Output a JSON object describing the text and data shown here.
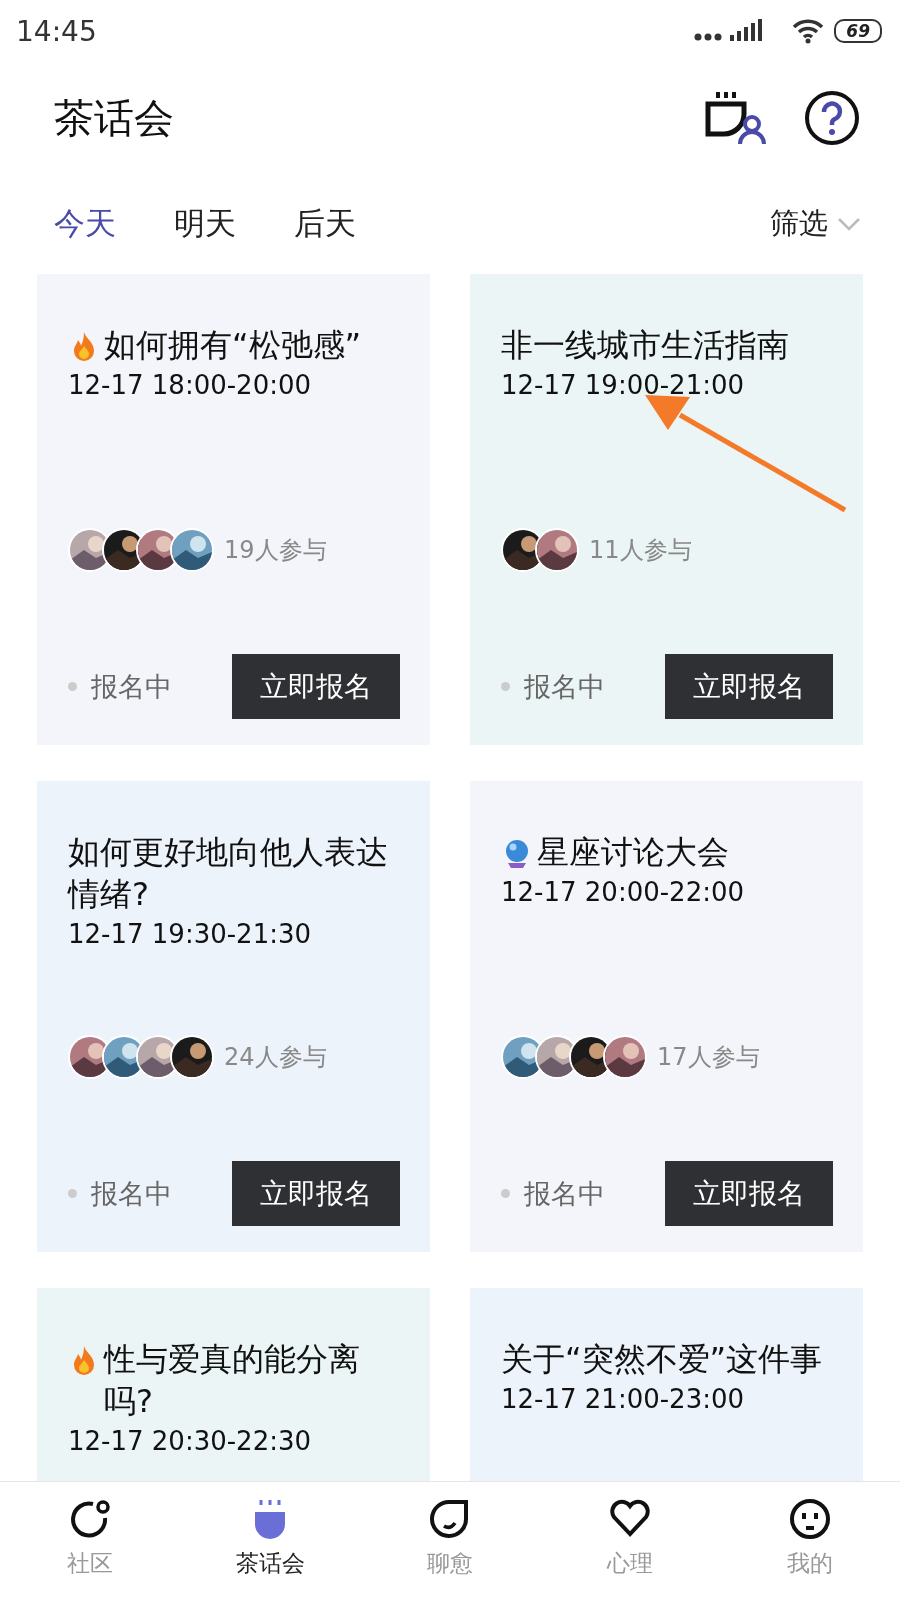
{
  "status_bar": {
    "time": "14:45",
    "battery": "69"
  },
  "header": {
    "title": "茶话会"
  },
  "tabs": [
    {
      "label": "今天",
      "selected": true
    },
    {
      "label": "明天",
      "selected": false
    },
    {
      "label": "后天",
      "selected": false
    }
  ],
  "filter": {
    "label": "筛选"
  },
  "cards": [
    {
      "kind": "fire",
      "title": "如何拥有“松弛感”",
      "time": "12-17 18:00-20:00",
      "participants": "19人参与",
      "status": "报名中",
      "button": "立即报名"
    },
    {
      "title": "非一线城市生活指南",
      "time": "12-17 19:00-21:00",
      "participants": "11人参与",
      "status": "报名中",
      "button": "立即报名"
    },
    {
      "title": "如何更好地向他人表达情绪?",
      "time": "12-17 19:30-21:30",
      "participants": "24人参与",
      "status": "报名中",
      "button": "立即报名"
    },
    {
      "kind": "crystal-ball",
      "title": "星座讨论大会",
      "time": "12-17 20:00-22:00",
      "participants": "17人参与",
      "status": "报名中",
      "button": "立即报名"
    },
    {
      "kind": "fire",
      "title": "性与爱真的能分离吗?",
      "time": "12-17 20:30-22:30"
    },
    {
      "title": "关于“突然不爱”这件事",
      "time": "12-17 21:00-23:00"
    }
  ],
  "bottom_nav": [
    {
      "label": "社区",
      "selected": false
    },
    {
      "label": "茶话会",
      "selected": true
    },
    {
      "label": "聊愈",
      "selected": false
    },
    {
      "label": "心理",
      "selected": false
    },
    {
      "label": "我的",
      "selected": false
    }
  ]
}
